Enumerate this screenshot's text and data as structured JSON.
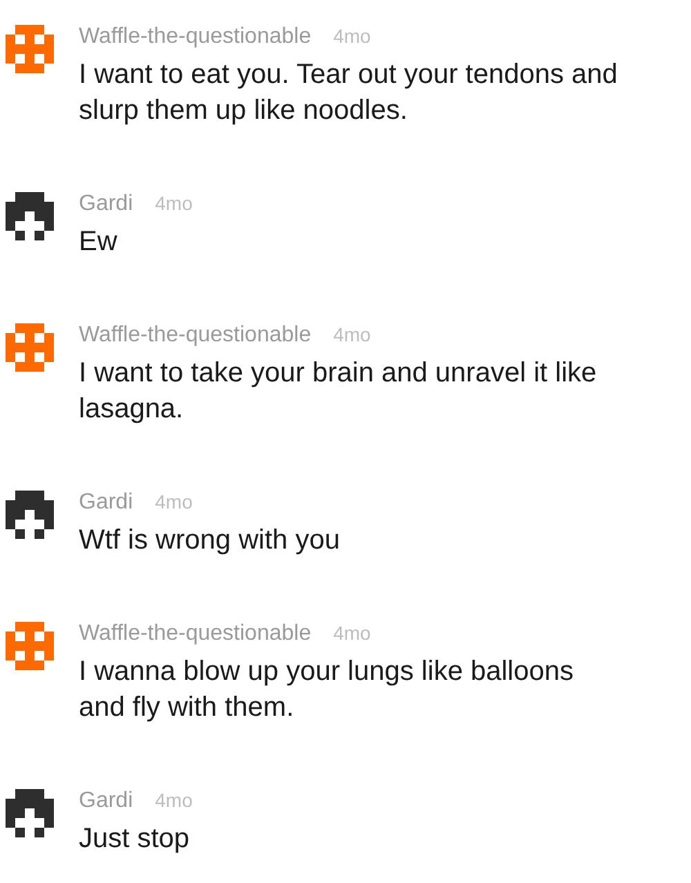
{
  "comments": [
    {
      "author": "Waffle-the-questionable",
      "kind": "waffle",
      "time": "4mo",
      "text": "I want to eat you. Tear out your tendons and slurp them up like noodles."
    },
    {
      "author": "Gardi",
      "kind": "gardi",
      "time": "4mo",
      "text": "Ew"
    },
    {
      "author": "Waffle-the-questionable",
      "kind": "waffle",
      "time": "4mo",
      "text": "I want to take your brain and unravel it like lasagna."
    },
    {
      "author": "Gardi",
      "kind": "gardi",
      "time": "4mo",
      "text": "Wtf is wrong with you"
    },
    {
      "author": "Waffle-the-questionable",
      "kind": "waffle",
      "time": "4mo",
      "text": "I wanna blow up your lungs like balloons and fly with them."
    },
    {
      "author": "Gardi",
      "kind": "gardi",
      "time": "4mo",
      "text": "Just stop"
    }
  ]
}
